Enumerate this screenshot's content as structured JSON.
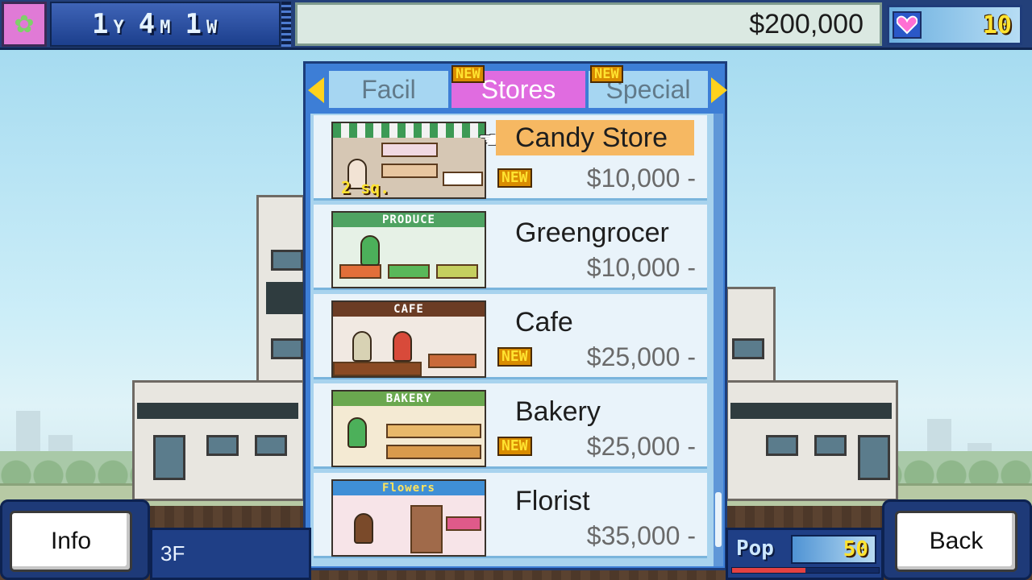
{
  "hud": {
    "date": {
      "years": "1",
      "year_unit": "Y",
      "months": "4",
      "month_unit": "M",
      "weeks": "1",
      "week_unit": "W"
    },
    "money": "$200,000",
    "hearts": "10",
    "heart_icon": "heart-icon"
  },
  "menu": {
    "tabs": [
      {
        "label": "Facil",
        "new": false,
        "active": false
      },
      {
        "label": "Stores",
        "new": true,
        "new_label": "NEW",
        "active": true
      },
      {
        "label": "Special",
        "new": true,
        "new_label": "NEW",
        "active": false
      }
    ],
    "items": [
      {
        "name": "Candy Store",
        "price": "$10,000 -",
        "new": "NEW",
        "size": "2 sq.",
        "selected": true
      },
      {
        "name": "Greengrocer",
        "price": "$10,000 -",
        "new": "",
        "sign": "PRODUCE"
      },
      {
        "name": "Cafe",
        "price": "$25,000 -",
        "new": "NEW",
        "sign": "CAFE"
      },
      {
        "name": "Bakery",
        "price": "$25,000 -",
        "new": "NEW",
        "sign": "BAKERY"
      },
      {
        "name": "Florist",
        "price": "$35,000 -",
        "new": "",
        "sign": "Flowers"
      }
    ]
  },
  "bottom": {
    "info_label": "Info",
    "back_label": "Back",
    "floor": "3F",
    "pop_label": "Pop",
    "pop_value": "50",
    "pop_fraction": 0.5
  },
  "colors": {
    "panel_blue": "#3d7ed6",
    "tab_active": "#e06ce0",
    "highlight": "#f6b862",
    "hud_blue": "#23407a"
  }
}
